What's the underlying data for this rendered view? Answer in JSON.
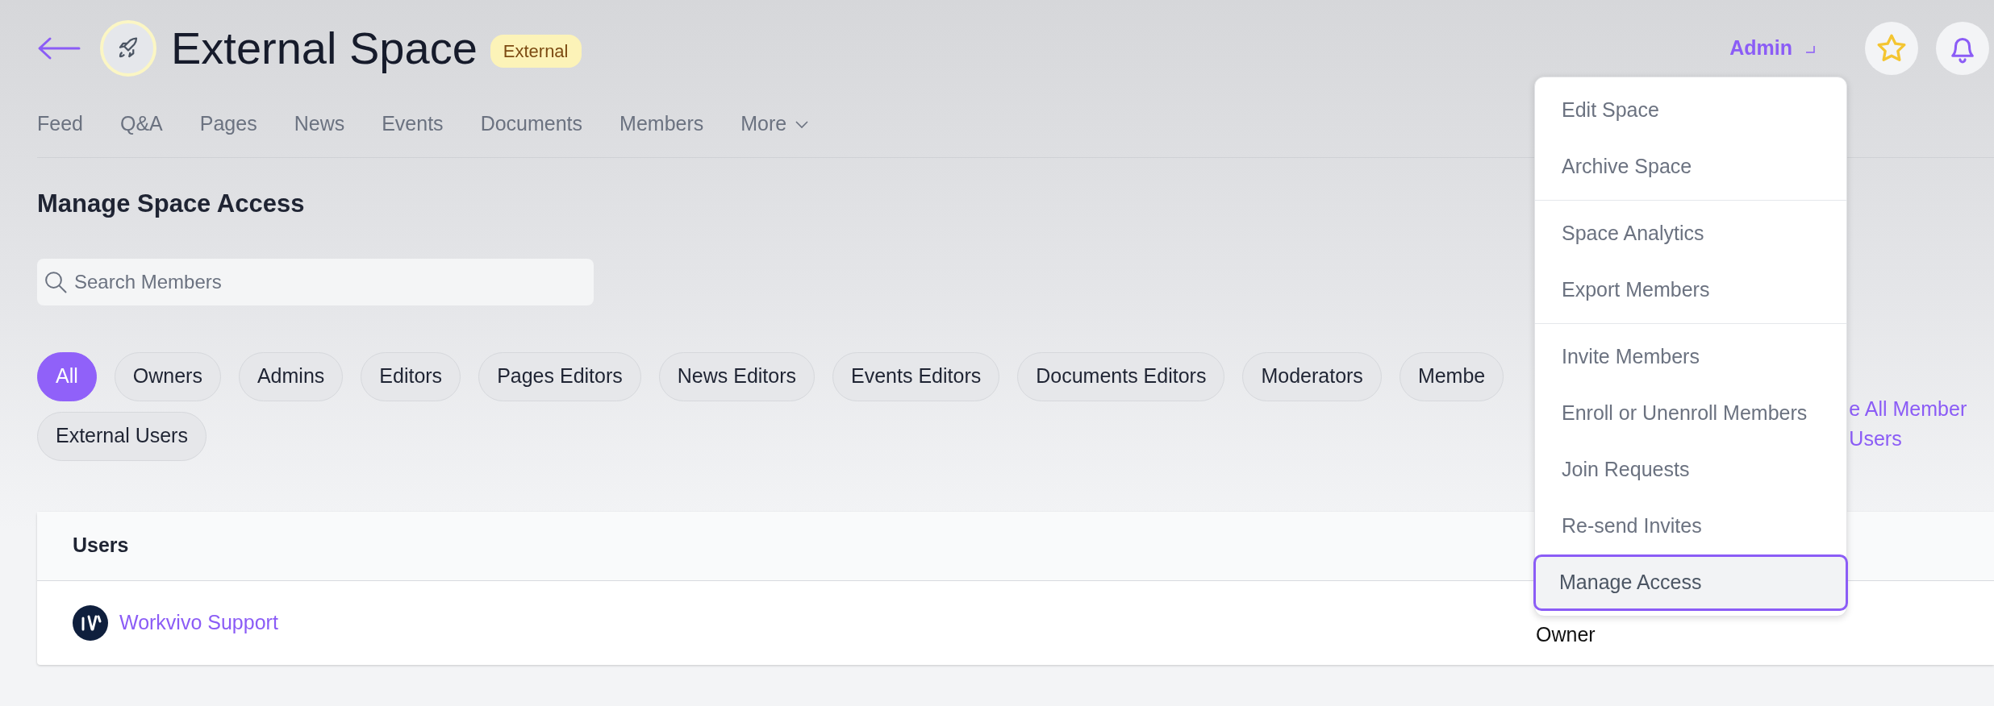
{
  "header": {
    "title": "External Space",
    "badge": "External",
    "admin_label": "Admin"
  },
  "tabs": [
    {
      "label": "Feed",
      "kind": "link"
    },
    {
      "label": "Q&A",
      "kind": "link"
    },
    {
      "label": "Pages",
      "kind": "link"
    },
    {
      "label": "News",
      "kind": "link"
    },
    {
      "label": "Events",
      "kind": "link"
    },
    {
      "label": "Documents",
      "kind": "link"
    },
    {
      "label": "Members",
      "kind": "link"
    },
    {
      "label": "More",
      "kind": "dropdown"
    }
  ],
  "section_title": "Manage Space Access",
  "search": {
    "placeholder": "Search Members"
  },
  "filters": [
    {
      "label": "All",
      "selected": true
    },
    {
      "label": "Owners",
      "selected": false
    },
    {
      "label": "Admins",
      "selected": false
    },
    {
      "label": "Editors",
      "selected": false
    },
    {
      "label": "Pages Editors",
      "selected": false
    },
    {
      "label": "News Editors",
      "selected": false
    },
    {
      "label": "Events Editors",
      "selected": false
    },
    {
      "label": "Documents Editors",
      "selected": false
    },
    {
      "label": "Moderators",
      "selected": false
    },
    {
      "label": "Membe",
      "selected": false
    },
    {
      "label": "External Users",
      "selected": false
    }
  ],
  "side_link": "e All Member Users",
  "table": {
    "columns": [
      "Users"
    ],
    "rows": [
      {
        "cells": [
          "Workvivo Support",
          "Owner"
        ]
      }
    ]
  },
  "menu": {
    "groups": [
      [
        {
          "label": "Edit Space",
          "selected": false
        },
        {
          "label": "Archive Space",
          "selected": false
        }
      ],
      [
        {
          "label": "Space Analytics",
          "selected": false
        },
        {
          "label": "Export Members",
          "selected": false
        }
      ],
      [
        {
          "label": "Invite Members",
          "selected": false
        },
        {
          "label": "Enroll or Unenroll Members",
          "selected": false
        },
        {
          "label": "Join Requests",
          "selected": false
        },
        {
          "label": "Re-send Invites",
          "selected": false
        },
        {
          "label": "Manage Access",
          "selected": true
        }
      ]
    ]
  }
}
